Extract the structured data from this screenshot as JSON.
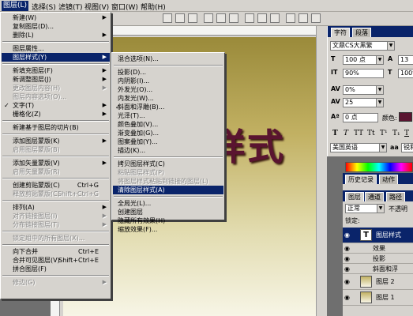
{
  "menubar": [
    "图层(L)",
    "选择(S)",
    "滤镜(T)",
    "视图(V)",
    "窗口(W)",
    "帮助(H)"
  ],
  "layer_menu": [
    {
      "label": "新建(W)",
      "arrow": true
    },
    {
      "label": "复制图层(D)..."
    },
    {
      "label": "删除(L)",
      "arrow": true
    },
    {
      "sep": true
    },
    {
      "label": "图层属性..."
    },
    {
      "label": "图层样式(Y)",
      "arrow": true,
      "selected": true
    },
    {
      "sep": true
    },
    {
      "label": "新填充图层(F)",
      "arrow": true
    },
    {
      "label": "新调整图层(J)",
      "arrow": true
    },
    {
      "label": "更改图层内容(H)",
      "arrow": true,
      "disabled": true
    },
    {
      "label": "图层内容选项(O)...",
      "disabled": true
    },
    {
      "label": "文字(T)",
      "arrow": true,
      "checked": true
    },
    {
      "label": "栅格化(Z)",
      "arrow": true
    },
    {
      "sep": true
    },
    {
      "label": "新建基于图层的切片(B)"
    },
    {
      "sep": true
    },
    {
      "label": "添加图层蒙版(K)",
      "arrow": true
    },
    {
      "label": "启用图层蒙版(B)",
      "disabled": true
    },
    {
      "sep": true
    },
    {
      "label": "添加矢量蒙版(V)",
      "arrow": true
    },
    {
      "label": "启用矢量蒙版(R)",
      "disabled": true
    },
    {
      "sep": true
    },
    {
      "label": "创建剪贴蒙版(C)",
      "shortcut": "Ctrl+G"
    },
    {
      "label": "释放剪贴蒙版(C)",
      "shortcut": "Shift+Ctrl+G",
      "disabled": true
    },
    {
      "sep": true
    },
    {
      "label": "排列(A)",
      "arrow": true
    },
    {
      "label": "对齐链接图层(I)",
      "arrow": true,
      "disabled": true
    },
    {
      "label": "分布链接图层(T)",
      "arrow": true,
      "disabled": true
    },
    {
      "sep": true
    },
    {
      "label": "锁定组中的所有图层(X)...",
      "disabled": true
    },
    {
      "sep": true
    },
    {
      "label": "向下合并",
      "shortcut": "Ctrl+E"
    },
    {
      "label": "合并可见图层(V)",
      "shortcut": "Shift+Ctrl+E"
    },
    {
      "label": "拼合图层(F)"
    },
    {
      "sep": true
    },
    {
      "label": "修边(G)",
      "arrow": true,
      "disabled": true
    }
  ],
  "style_submenu": [
    {
      "label": "混合选项(N)..."
    },
    {
      "sep": true
    },
    {
      "label": "投影(D)..."
    },
    {
      "label": "内阴影(I)..."
    },
    {
      "label": "外发光(O)..."
    },
    {
      "label": "内发光(W)..."
    },
    {
      "label": "斜面和浮雕(B)...",
      "checked": true
    },
    {
      "label": "光泽(T)..."
    },
    {
      "label": "颜色叠加(V)..."
    },
    {
      "label": "渐变叠加(G)..."
    },
    {
      "label": "图案叠加(Y)..."
    },
    {
      "label": "描边(K)..."
    },
    {
      "sep": true
    },
    {
      "label": "拷贝图层样式(C)"
    },
    {
      "label": "粘贴图层样式(P)",
      "disabled": true
    },
    {
      "label": "将图层样式粘贴到链接的图层(L)",
      "disabled": true
    },
    {
      "label": "清除图层样式(A)",
      "selected": true
    },
    {
      "sep": true
    },
    {
      "label": "全局光(L)..."
    },
    {
      "label": "创建图层"
    },
    {
      "label": "隐藏所有效果(H)"
    },
    {
      "label": "缩放效果(F)..."
    }
  ],
  "canvas": {
    "text": "样式"
  },
  "character_panel": {
    "tabs": [
      "字符",
      "段落"
    ],
    "font_family": "文鼎CS大黑繁",
    "font_size": "100 点",
    "leading": "13",
    "vertical_scale": "90%",
    "horizontal_scale": "100%",
    "tracking_left": "0%",
    "kerning": "25",
    "baseline": "0 点",
    "color_label": "颜色:",
    "language": "美国英语",
    "antialias": "锐利",
    "colors": {
      "text_color": "#5a1430"
    }
  },
  "history_tabs": [
    "历史记录",
    "动作"
  ],
  "layers_panel": {
    "tabs": [
      "图层",
      "通道",
      "路径"
    ],
    "blend_mode": "正常",
    "opacity_label": "不透明",
    "lock_label": "锁定:",
    "layers": [
      {
        "name": "图层样式",
        "thumb": "T",
        "selected": true
      },
      {
        "name": "效果",
        "sub": true
      },
      {
        "name": "投影",
        "sub": true
      },
      {
        "name": "斜面和浮",
        "sub": true
      },
      {
        "name": "图层 2"
      },
      {
        "name": "图层 1"
      }
    ]
  }
}
